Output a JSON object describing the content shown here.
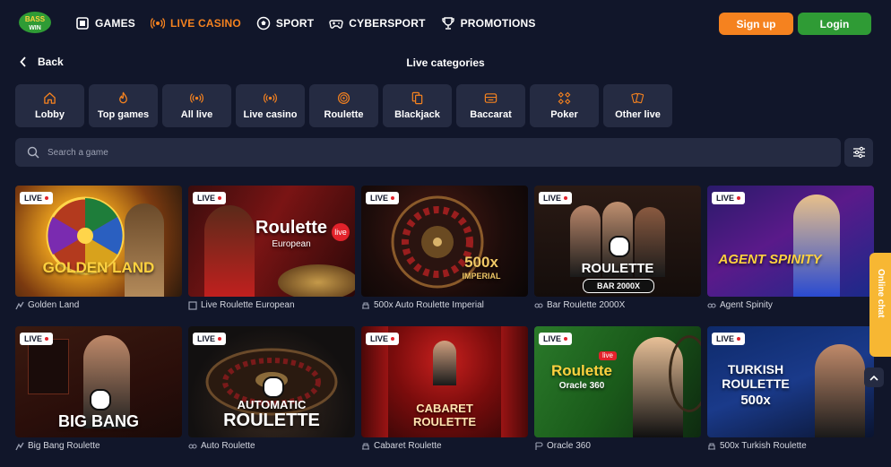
{
  "header": {
    "logo_text": "BASS WIN",
    "nav": [
      {
        "label": "GAMES",
        "icon": "games-icon"
      },
      {
        "label": "LIVE CASINO",
        "icon": "live-icon"
      },
      {
        "label": "SPORT",
        "icon": "ball-icon"
      },
      {
        "label": "CYBERSPORT",
        "icon": "gamepad-icon"
      },
      {
        "label": "PROMOTIONS",
        "icon": "trophy-icon"
      }
    ],
    "signup_label": "Sign up",
    "login_label": "Login",
    "accent": "#f5821f",
    "login_color": "#2f9b35"
  },
  "back_label": "Back",
  "page_title": "Live categories",
  "categories": [
    {
      "label": "Lobby",
      "icon": "home-icon"
    },
    {
      "label": "Top games",
      "icon": "flame-icon"
    },
    {
      "label": "All live",
      "icon": "broadcast-icon"
    },
    {
      "label": "Live casino",
      "icon": "broadcast-icon"
    },
    {
      "label": "Roulette",
      "icon": "roulette-icon"
    },
    {
      "label": "Blackjack",
      "icon": "cards-icon"
    },
    {
      "label": "Baccarat",
      "icon": "baccarat-icon"
    },
    {
      "label": "Poker",
      "icon": "poker-icon"
    },
    {
      "label": "Other live",
      "icon": "card-fan-icon"
    }
  ],
  "search": {
    "placeholder": "Search a game"
  },
  "live_badge": "LIVE",
  "games": [
    {
      "title": "Golden Land",
      "art": "GOLDEN LAND",
      "provider_icon": "provider-icon"
    },
    {
      "title": "Live Roulette European",
      "art": "Roulette",
      "art2": "European",
      "provider_icon": "provider-icon"
    },
    {
      "title": "500x Auto Roulette Imperial",
      "art": "500x",
      "art2": "IMPERIAL",
      "provider_icon": "provider-icon"
    },
    {
      "title": "Bar Roulette 2000X",
      "art": "ROULETTE",
      "art2": "BAR 2000X",
      "provider_icon": "provider-icon"
    },
    {
      "title": "Agent Spinity",
      "art": "AGENT SPINITY",
      "provider_icon": "provider-icon"
    },
    {
      "title": "Big Bang Roulette",
      "art": "BIG BANG",
      "provider_icon": "provider-icon"
    },
    {
      "title": "Auto Roulette",
      "art": "AUTOMATIC",
      "art2": "ROULETTE",
      "provider_icon": "provider-icon"
    },
    {
      "title": "Cabaret Roulette",
      "art": "CABARET ROULETTE",
      "provider_icon": "provider-icon"
    },
    {
      "title": "Oracle 360",
      "art": "Roulette",
      "art2": "Oracle 360",
      "provider_icon": "provider-icon"
    },
    {
      "title": "500x Turkish Roulette",
      "art": "TURKISH ROULETTE",
      "art2": "500x",
      "provider_icon": "provider-icon"
    }
  ],
  "online_chat_label": "Online chat"
}
